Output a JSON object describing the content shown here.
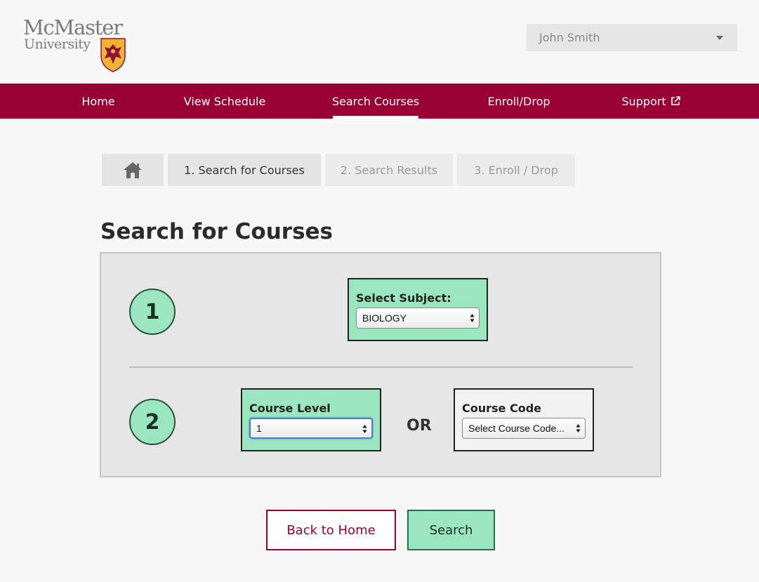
{
  "logo": {
    "line1": "McMaster",
    "line2": "University"
  },
  "user": {
    "name": "John Smith"
  },
  "nav": {
    "items": [
      {
        "label": "Home"
      },
      {
        "label": "View Schedule"
      },
      {
        "label": "Search Courses",
        "active": true
      },
      {
        "label": "Enroll/Drop"
      },
      {
        "label": "Support",
        "external": true
      }
    ]
  },
  "steps": {
    "home_icon": "home-icon",
    "items": [
      {
        "label": "1. Search for Courses",
        "state": "current"
      },
      {
        "label": "2. Search Results",
        "state": "disabled"
      },
      {
        "label": "3. Enroll / Drop",
        "state": "disabled"
      }
    ]
  },
  "page": {
    "title": "Search for Courses"
  },
  "form": {
    "step1": {
      "number": "1",
      "label": "Select Subject:",
      "value": "BIOLOGY"
    },
    "step2": {
      "number": "2",
      "level_label": "Course Level",
      "level_value": "1",
      "or_label": "OR",
      "code_label": "Course Code",
      "code_value": "Select Course Code..."
    }
  },
  "buttons": {
    "back": "Back to Home",
    "search": "Search"
  },
  "colors": {
    "brand": "#990033",
    "accent_green": "#9ae6c0",
    "panel": "#e6e6e6"
  }
}
